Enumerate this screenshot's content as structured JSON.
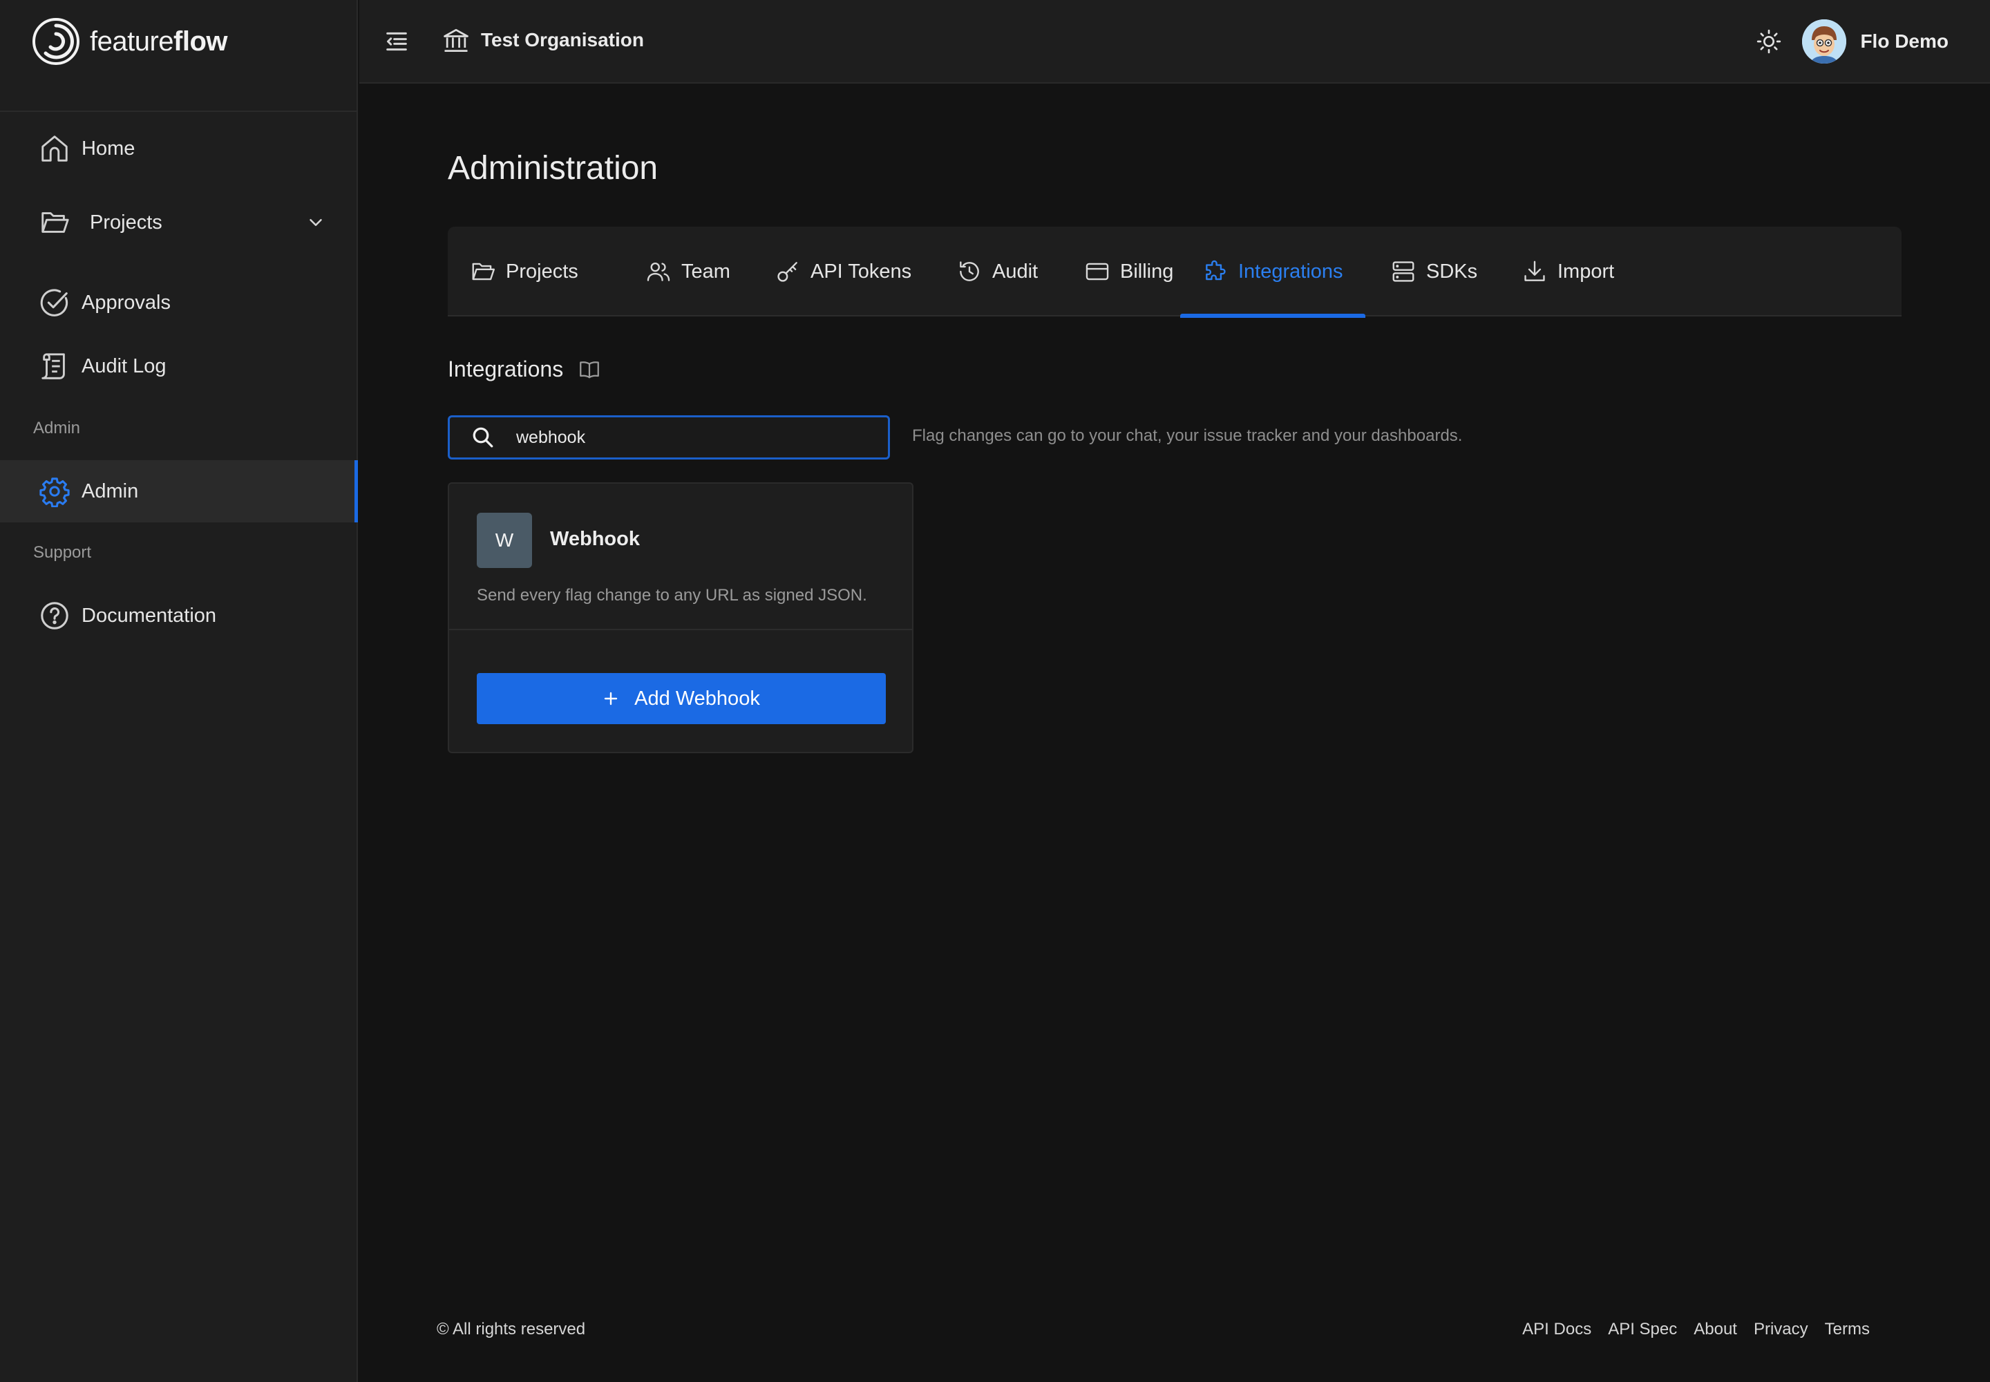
{
  "brand": {
    "name_light": "feature",
    "name_bold": "flow"
  },
  "sidebar": {
    "items": [
      {
        "label": "Home",
        "icon": "home-icon"
      },
      {
        "label": "Projects",
        "icon": "folder-open-icon",
        "expandable": true
      },
      {
        "label": "Approvals",
        "icon": "check-circle-icon"
      },
      {
        "label": "Audit Log",
        "icon": "scroll-icon"
      }
    ],
    "section_admin": "Admin",
    "admin_item": {
      "label": "Admin",
      "icon": "gear-icon",
      "active": true
    },
    "section_support": "Support",
    "support_item": {
      "label": "Documentation",
      "icon": "question-circle-icon"
    }
  },
  "topbar": {
    "organisation": "Test Organisation",
    "user_name": "Flo Demo"
  },
  "page": {
    "title": "Administration",
    "tabs": [
      {
        "label": "Projects",
        "icon": "folder-open-icon"
      },
      {
        "label": "Team",
        "icon": "users-icon"
      },
      {
        "label": "API Tokens",
        "icon": "key-icon"
      },
      {
        "label": "Audit",
        "icon": "history-icon"
      },
      {
        "label": "Billing",
        "icon": "credit-card-icon"
      },
      {
        "label": "Integrations",
        "icon": "puzzle-icon",
        "active": true
      },
      {
        "label": "SDKs",
        "icon": "server-icon"
      },
      {
        "label": "Import",
        "icon": "download-icon"
      }
    ],
    "section_title": "Integrations",
    "search": {
      "value": "webhook"
    },
    "search_hint": "Flag changes can go to your chat, your issue tracker and your dashboards.",
    "card": {
      "badge": "W",
      "title": "Webhook",
      "description": "Send every flag change to any URL as signed JSON.",
      "button": "Add Webhook"
    }
  },
  "footer": {
    "copyright": "© All rights reserved",
    "links": [
      "API Docs",
      "API Spec",
      "About",
      "Privacy",
      "Terms"
    ]
  },
  "colors": {
    "accent": "#1b6ae4",
    "background": "#131313",
    "surface": "#1e1e1e",
    "badge": "#4a5a66"
  }
}
